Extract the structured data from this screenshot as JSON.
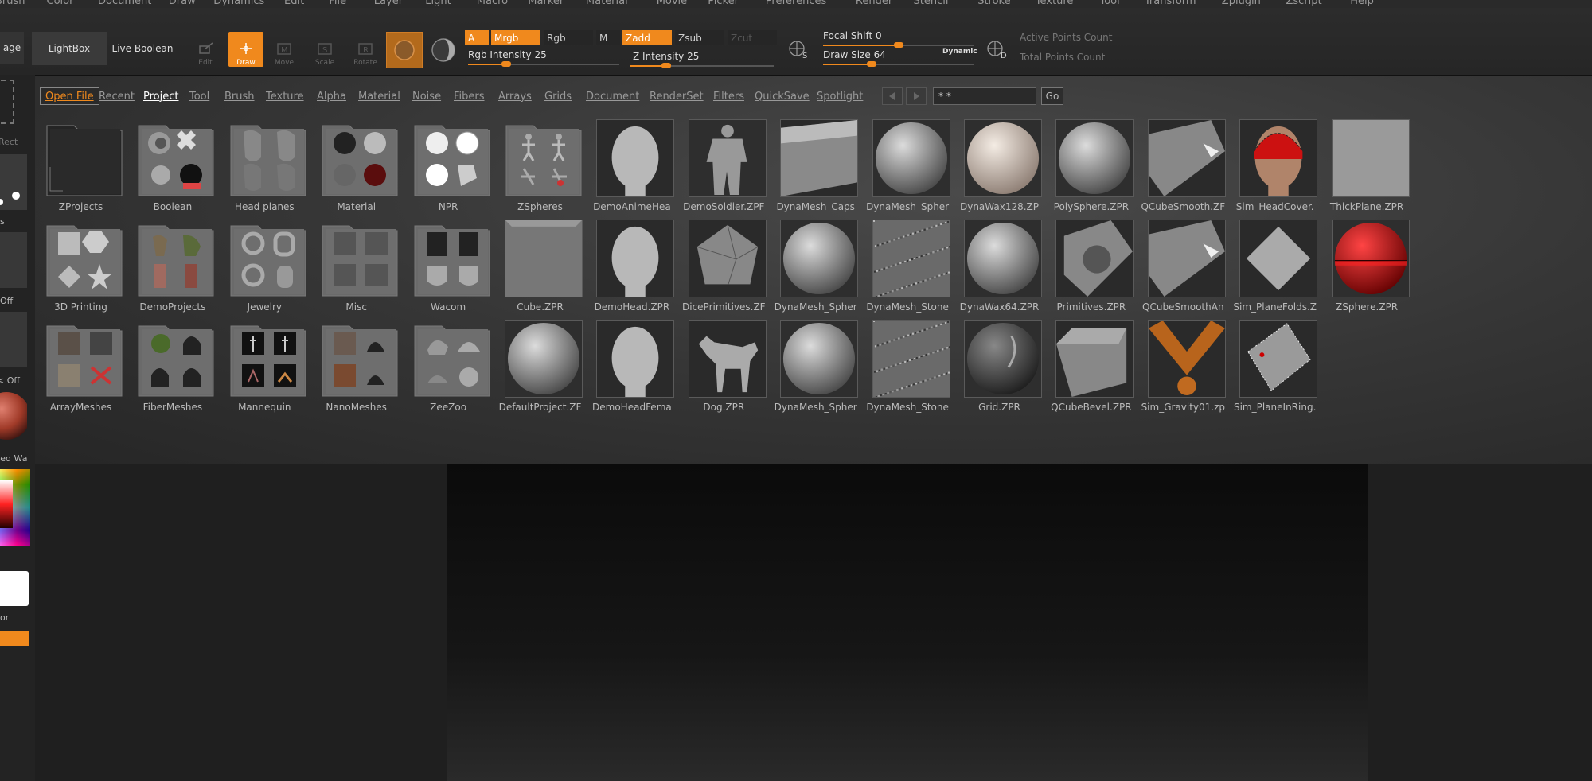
{
  "menubar": [
    "Brush",
    "Color",
    "Document",
    "Draw",
    "Dynamics",
    "Edit",
    "File",
    "Layer",
    "Light",
    "Macro",
    "Marker",
    "Material",
    "Movie",
    "Picker",
    "Preferences",
    "Render",
    "Stencil",
    "Stroke",
    "Texture",
    "Tool",
    "Transform",
    "Zplugin",
    "Zscript",
    "Help"
  ],
  "toolbar": {
    "page_label": "age",
    "lightbox_label": "LightBox",
    "liveboolean_label": "Live Boolean",
    "tools": [
      {
        "label": "Edit"
      },
      {
        "label": "Draw"
      },
      {
        "label": "Move"
      },
      {
        "label": "Scale"
      },
      {
        "label": "Rotate"
      }
    ],
    "a_label": "A",
    "mrgb_label": "Mrgb",
    "rgb_label": "Rgb",
    "m_label": "M",
    "zadd_label": "Zadd",
    "zsub_label": "Zsub",
    "zcut_label": "Zcut",
    "rgb_intensity_label": "Rgb Intensity",
    "rgb_intensity_value": "25",
    "rgb_intensity": 0.25,
    "z_intensity_label": "Z Intensity",
    "z_intensity_value": "25",
    "z_intensity": 0.25,
    "focal_shift_label": "Focal Shift",
    "focal_shift_value": "0",
    "focal_shift": 0.5,
    "draw_size_label": "Draw Size",
    "draw_size_value": "64",
    "draw_size": 0.32,
    "dynamic_label": "Dynamic",
    "s_label": "S",
    "d_label": "D",
    "active_points_label": "Active Points Count",
    "total_points_label": "Total Points Count"
  },
  "leftpanel": {
    "rect_label": "Rect",
    "s_label": "s",
    "off1_label": "Off",
    "off2_label": "< Off",
    "material_label": "red Wa",
    "color_label": "or"
  },
  "browser": {
    "tabs": [
      "Open File",
      "Recent",
      "Project",
      "Tool",
      "Brush",
      "Texture",
      "Alpha",
      "Material",
      "Noise",
      "Fibers",
      "Arrays",
      "Grids",
      "Document",
      "RenderSet",
      "Filters",
      "QuickSave",
      "Spotlight"
    ],
    "current_tab": "Project",
    "search_value": "* *",
    "go_label": "Go",
    "items": [
      [
        "ZProjects",
        "Boolean",
        "Head planes",
        "Material",
        "NPR",
        "ZSpheres",
        "DemoAnimeHea",
        "DemoSoldier.ZPF",
        "DynaMesh_Caps",
        "DynaMesh_Spher",
        "DynaWax128.ZP",
        "PolySphere.ZPR",
        "QCubeSmooth.ZF",
        "Sim_HeadCover.",
        "ThickPlane.ZPR"
      ],
      [
        "3D Printing",
        "DemoProjects",
        "Jewelry",
        "Misc",
        "Wacom",
        "Cube.ZPR",
        "DemoHead.ZPR",
        "DicePrimitives.ZF",
        "DynaMesh_Spher",
        "DynaMesh_Stone",
        "DynaWax64.ZPR",
        "Primitives.ZPR",
        "QCubeSmoothAn",
        "Sim_PlaneFolds.Z",
        "ZSphere.ZPR"
      ],
      [
        "ArrayMeshes",
        "FiberMeshes",
        "Mannequin",
        "NanoMeshes",
        "ZeeZoo",
        "DefaultProject.ZF",
        "DemoHeadFema",
        "Dog.ZPR",
        "DynaMesh_Spher",
        "DynaMesh_Stone",
        "Grid.ZPR",
        "QCubeBevel.ZPR",
        "Sim_Gravity01.zp",
        "Sim_PlaneInRing."
      ]
    ]
  },
  "colors": {
    "accent": "#f0891d",
    "panel": "#262626",
    "text": "#bbbbbb"
  }
}
